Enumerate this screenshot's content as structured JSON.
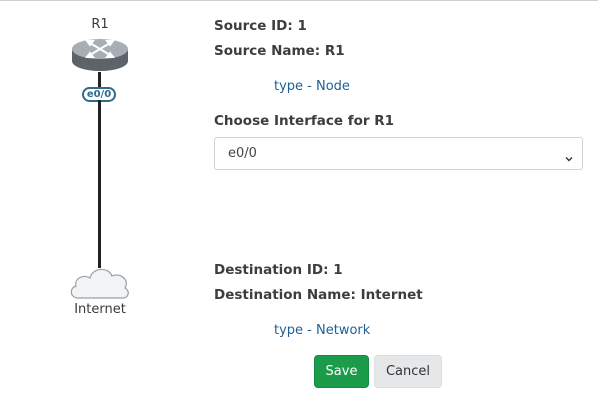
{
  "diagram": {
    "source_node_label": "R1",
    "interface_badge": "e0/0",
    "destination_node_label": "Internet",
    "router_icon": "router-icon",
    "cloud_icon": "cloud-icon"
  },
  "source": {
    "id_text": "Source ID: 1",
    "name_text": "Source Name: R1",
    "type_text": "type - Node"
  },
  "interface": {
    "label": "Choose Interface for R1",
    "selected": "e0/0"
  },
  "destination": {
    "id_text": "Destination ID: 1",
    "name_text": "Destination Name: Internet",
    "type_text": "type - Network"
  },
  "actions": {
    "save_label": "Save",
    "cancel_label": "Cancel"
  },
  "colors": {
    "save_green": "#1a9c4a",
    "link_blue": "#1f5f96",
    "badge_blue": "#2d6a8e"
  }
}
